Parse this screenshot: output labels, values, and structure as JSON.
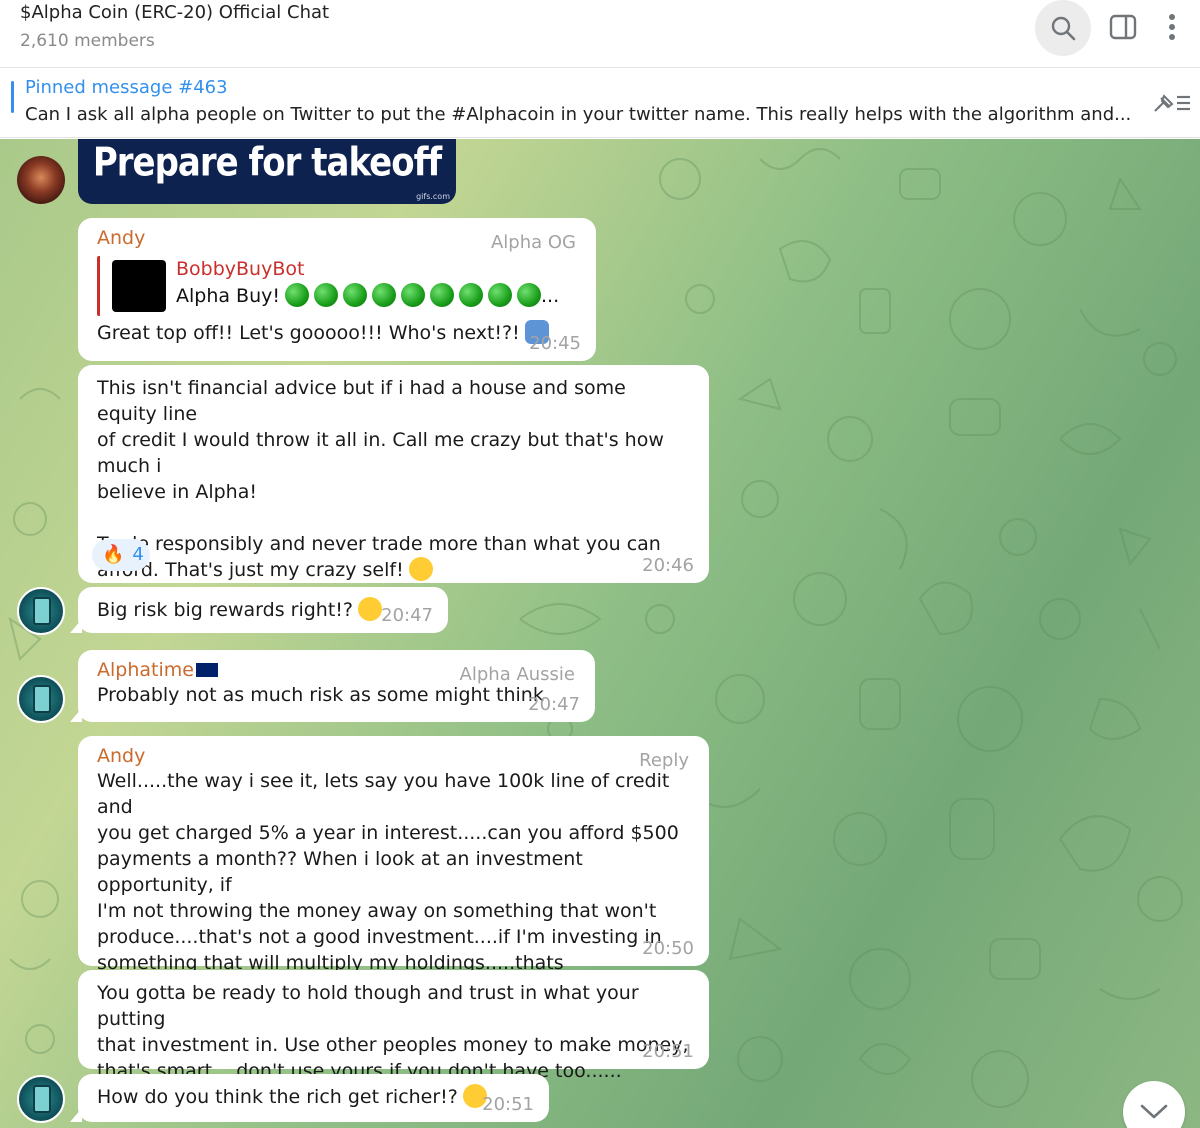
{
  "header": {
    "title": "$Alpha Coin (ERC-20) Official Chat",
    "members": "2,610 members"
  },
  "pinned": {
    "title": "Pinned message #463",
    "text": "Can I ask all alpha people on Twitter to put the #Alphacoin in your twitter name.  This really helps with the algorithm and..."
  },
  "gif": {
    "text": "Prepare for takeoff",
    "credit": "gifs.com"
  },
  "messages": [
    {
      "sender": "Andy",
      "rank": "Alpha OG",
      "reply_name": "BobbyBuyBot",
      "reply_text": "Alpha Buy!",
      "reply_ellipsis": "...",
      "text": "Great top off!! Let's gooooo!!! Who's next!?!",
      "time": "20:45"
    },
    {
      "text": "This isn't financial advice but if i had a house and some equity line\nof credit I would throw it all in. Call me crazy but that's how much i\nbelieve in Alpha!\n\nTrade responsibly and never trade more than what you can\nafford. That's just my crazy self!",
      "reaction_emoji": "🔥",
      "reaction_count": "4",
      "time": "20:46"
    },
    {
      "text": "Big risk big rewards right!?",
      "time": "20:47"
    },
    {
      "sender": "Alphatime",
      "rank": "Alpha Aussie",
      "text": "Probably not as much risk as some might think",
      "time": "20:47"
    },
    {
      "sender": "Andy",
      "rank": "Reply",
      "text": "Well.....the way i see it, lets say you have 100k line of credit and\nyou get charged 5% a year in interest.....can you afford $500\npayments a month?? When i look at an investment opportunity, if\nI'm not throwing the money away on something that won't\nproduce....that's not a good investment....if I'm investing in\nsomething that will multiply my holdings.....thats SMART.....again\nthat's how i think....",
      "time": "20:50"
    },
    {
      "text": "You gotta be ready to hold though and trust in what your putting\nthat investment in. Use other peoples money to make money,\nthat's smart....don't use yours if you don't have too......",
      "time": "20:51"
    },
    {
      "text": "How do you think the rich get richer!?",
      "time": "20:51"
    }
  ]
}
